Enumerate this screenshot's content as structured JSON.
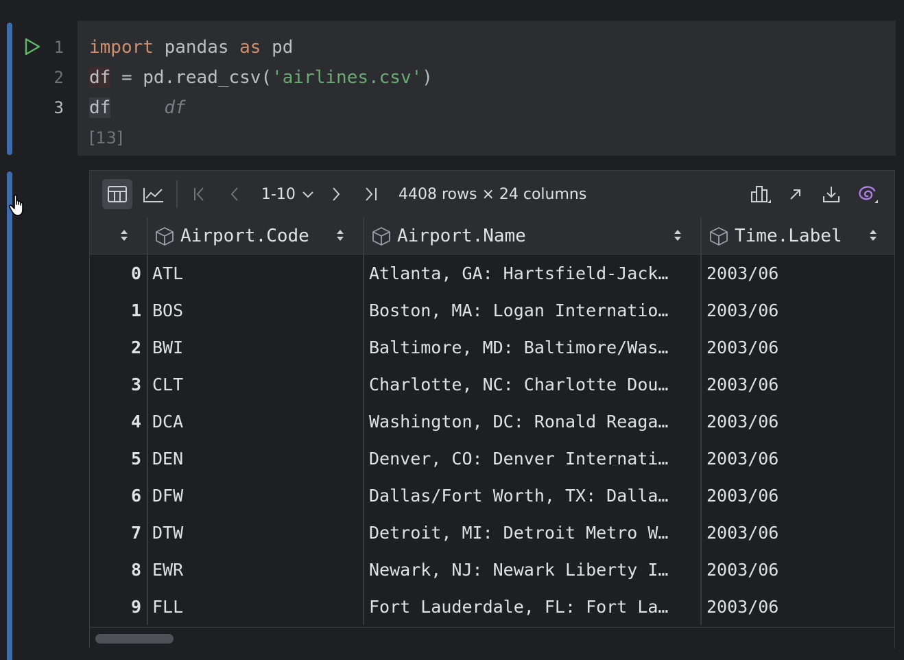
{
  "cell": {
    "line_numbers": [
      "1",
      "2",
      "3"
    ],
    "line1": {
      "kw_import": "import",
      "mod": " pandas ",
      "kw_as": "as",
      "alias": " pd"
    },
    "line2": {
      "var": "df",
      "rest": " = pd.read_csv(",
      "str": "'airlines.csv'",
      "end": ")"
    },
    "line3": {
      "var": "df",
      "hint": "df"
    },
    "execution_count": "[13]"
  },
  "toolbar": {
    "page_range": "1-10",
    "rows_info": "4408 rows × 24 columns",
    "accent": "#b07ee8"
  },
  "table": {
    "columns": [
      "Airport.Code",
      "Airport.Name",
      "Time.Label"
    ],
    "rows": [
      {
        "idx": "0",
        "code": "ATL",
        "name": "Atlanta, GA: Hartsfield-Jack…",
        "time": "2003/06"
      },
      {
        "idx": "1",
        "code": "BOS",
        "name": "Boston, MA: Logan Internatio…",
        "time": "2003/06"
      },
      {
        "idx": "2",
        "code": "BWI",
        "name": "Baltimore, MD: Baltimore/Was…",
        "time": "2003/06"
      },
      {
        "idx": "3",
        "code": "CLT",
        "name": "Charlotte, NC: Charlotte Dou…",
        "time": "2003/06"
      },
      {
        "idx": "4",
        "code": "DCA",
        "name": "Washington, DC: Ronald Reaga…",
        "time": "2003/06"
      },
      {
        "idx": "5",
        "code": "DEN",
        "name": "Denver, CO: Denver Internati…",
        "time": "2003/06"
      },
      {
        "idx": "6",
        "code": "DFW",
        "name": "Dallas/Fort Worth, TX: Dalla…",
        "time": "2003/06"
      },
      {
        "idx": "7",
        "code": "DTW",
        "name": "Detroit, MI: Detroit Metro W…",
        "time": "2003/06"
      },
      {
        "idx": "8",
        "code": "EWR",
        "name": "Newark, NJ: Newark Liberty I…",
        "time": "2003/06"
      },
      {
        "idx": "9",
        "code": "FLL",
        "name": "Fort Lauderdale, FL: Fort La…",
        "time": "2003/06"
      }
    ]
  }
}
